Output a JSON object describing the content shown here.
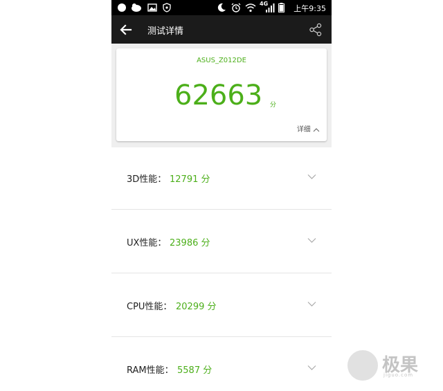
{
  "status_bar": {
    "time": "上午9:35",
    "network": "4G",
    "icons": [
      "notification-icon",
      "notification-icon",
      "gallery-icon",
      "shield-icon",
      "moon-icon",
      "alarm-icon",
      "wifi-icon",
      "signal-icon",
      "battery-icon"
    ]
  },
  "app_bar": {
    "title": "测试详情",
    "back_icon": "arrow-left-icon",
    "share_icon": "share-icon"
  },
  "score_card": {
    "device_name": "ASUS_Z012DE",
    "total_score": "62663",
    "unit": "分",
    "details_label": "详细"
  },
  "categories": [
    {
      "label": "3D性能：",
      "score": "12791 分"
    },
    {
      "label": "UX性能：",
      "score": "23986 分"
    },
    {
      "label": "CPU性能：",
      "score": "20299 分"
    },
    {
      "label": "RAM性能：",
      "score": "5587 分"
    }
  ],
  "watermark": {
    "brand": "极果",
    "sub": "jiguo.com"
  },
  "colors": {
    "accent": "#4caf1a",
    "app_bar": "#1b1b1b",
    "status_bar": "#000000"
  }
}
